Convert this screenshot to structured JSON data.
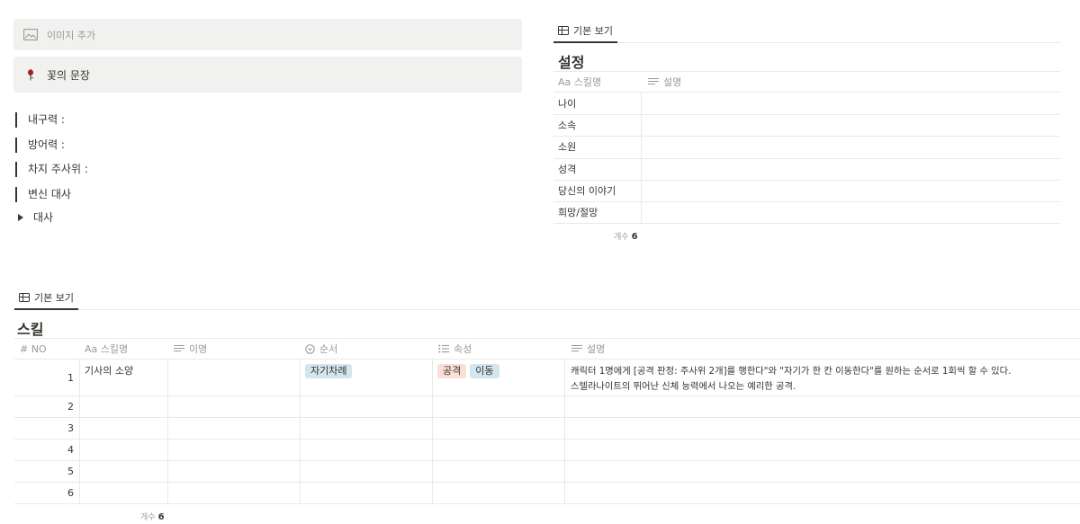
{
  "page": {
    "add_image": "이미지 추가",
    "callout": "꽃의 문장",
    "quotes": [
      "내구력 :",
      "방어력 :",
      "차지 주사위 :",
      "변신 대사"
    ],
    "toggle": "대사"
  },
  "settings_db": {
    "view_tab": "기본 보기",
    "title": "설정",
    "headers": [
      "Aa 스킬명",
      "설명"
    ],
    "rows": [
      "나이",
      "소속",
      "소원",
      "성격",
      "당신의 이야기",
      "희망/절망"
    ],
    "count_label": "개수",
    "count_value": "6"
  },
  "skills_db": {
    "view_tab": "기본 보기",
    "title": "스킬",
    "headers": [
      "# NO",
      "Aa 스킬명",
      "이명",
      "순서",
      "속성",
      "설명"
    ],
    "rows": [
      {
        "no": "1",
        "name": "기사의 소양",
        "alias": "",
        "order": "자기차례",
        "attrs": [
          "공격",
          "이동"
        ],
        "desc1": "캐릭터 1명에게 [공격 판정: 주사위 2개]를 행한다\"와 \"자기가 한 칸 이동한다\"를 원하는 순서로 1회씩 할 수 있다.",
        "desc2": "스텔라나이트의 뛰어난 신체 능력에서 나오는 예리한 공격."
      },
      {
        "no": "2"
      },
      {
        "no": "3"
      },
      {
        "no": "4"
      },
      {
        "no": "5"
      },
      {
        "no": "6"
      }
    ],
    "count_label": "개수",
    "count_value": "6"
  },
  "colors": {
    "block_bg": "#f1f1ef",
    "tag_order_bg": "#d3e5ef",
    "tag_attack_bg": "#fadfd6",
    "tag_move_bg": "#d3e5ef",
    "flower_red": "#a4202a"
  },
  "icons": [
    "image-icon",
    "rose-icon",
    "table-icon",
    "lines-icon",
    "clock-icon",
    "list-icon",
    "hash-icon",
    "caret-right-icon"
  ]
}
